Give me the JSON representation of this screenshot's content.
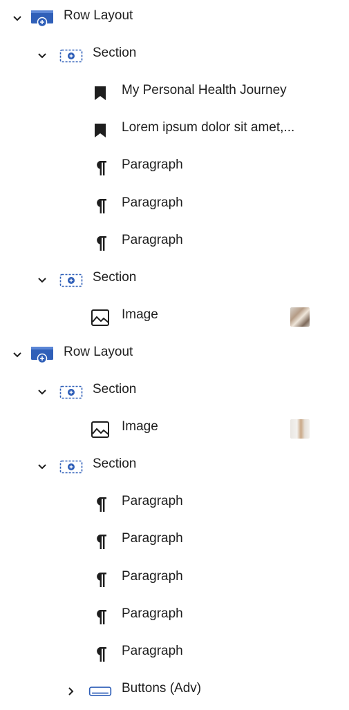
{
  "tree": [
    {
      "label": "Row Layout",
      "type": "row-layout",
      "level": 0,
      "expand": "down"
    },
    {
      "label": "Section",
      "type": "section",
      "level": 1,
      "expand": "down"
    },
    {
      "label": "My Personal Health Journey",
      "type": "heading",
      "level": 2
    },
    {
      "label": "Lorem ipsum dolor sit amet,...",
      "type": "heading",
      "level": 2
    },
    {
      "label": "Paragraph",
      "type": "paragraph",
      "level": 2
    },
    {
      "label": "Paragraph",
      "type": "paragraph",
      "level": 2
    },
    {
      "label": "Paragraph",
      "type": "paragraph",
      "level": 2
    },
    {
      "label": "Section",
      "type": "section",
      "level": 1,
      "expand": "down"
    },
    {
      "label": "Image",
      "type": "image",
      "level": 2,
      "thumb": "a"
    },
    {
      "label": "Row Layout",
      "type": "row-layout",
      "level": 0,
      "expand": "down"
    },
    {
      "label": "Section",
      "type": "section",
      "level": 1,
      "expand": "down"
    },
    {
      "label": "Image",
      "type": "image",
      "level": 2,
      "thumb": "b"
    },
    {
      "label": "Section",
      "type": "section",
      "level": 1,
      "expand": "down"
    },
    {
      "label": "Paragraph",
      "type": "paragraph",
      "level": 2
    },
    {
      "label": "Paragraph",
      "type": "paragraph",
      "level": 2
    },
    {
      "label": "Paragraph",
      "type": "paragraph",
      "level": 2
    },
    {
      "label": "Paragraph",
      "type": "paragraph",
      "level": 2
    },
    {
      "label": "Paragraph",
      "type": "paragraph",
      "level": 2
    },
    {
      "label": "Buttons (Adv)",
      "type": "buttons",
      "level": 2,
      "expand": "right"
    }
  ],
  "colors": {
    "accent": "#2f5fb8",
    "text": "#1e1e1e"
  }
}
